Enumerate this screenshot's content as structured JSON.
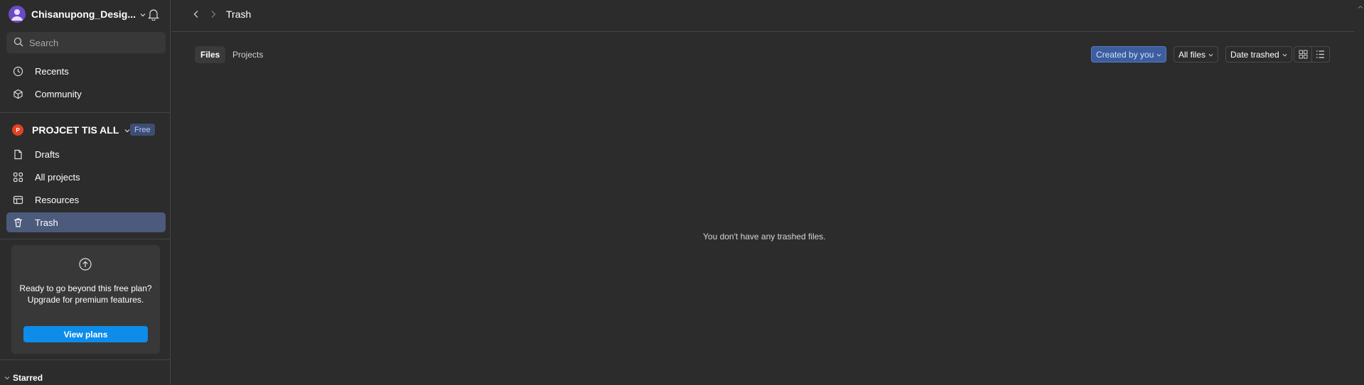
{
  "sidebar": {
    "account_name": "Chisanupong_Desig...",
    "search_placeholder": "Search",
    "top_items": [
      {
        "label": "Recents",
        "icon": "clock-icon"
      },
      {
        "label": "Community",
        "icon": "community-icon"
      }
    ],
    "team": {
      "badge": "P",
      "name": "PROJCET TIS ALL",
      "plan": "Free"
    },
    "team_items": [
      {
        "label": "Drafts",
        "icon": "file-icon"
      },
      {
        "label": "All projects",
        "icon": "grid-icon"
      },
      {
        "label": "Resources",
        "icon": "resources-icon"
      },
      {
        "label": "Trash",
        "icon": "trash-icon",
        "active": true
      }
    ],
    "upgrade": {
      "text": "Ready to go beyond this free plan? Upgrade for premium features.",
      "button": "View plans"
    },
    "starred_label": "Starred"
  },
  "header": {
    "title": "Trash"
  },
  "tabs": [
    {
      "label": "Files",
      "active": true
    },
    {
      "label": "Projects",
      "active": false
    }
  ],
  "filters": {
    "owner": "Created by you",
    "type": "All files",
    "sort": "Date trashed"
  },
  "empty_message": "You don't have any trashed files.",
  "colors": {
    "background": "#2c2c2c",
    "active_nav": "#4c5a7c",
    "primary_button": "#0d8ce9",
    "active_filter": "#3d5e9e",
    "team_badge": "#e2421f"
  }
}
